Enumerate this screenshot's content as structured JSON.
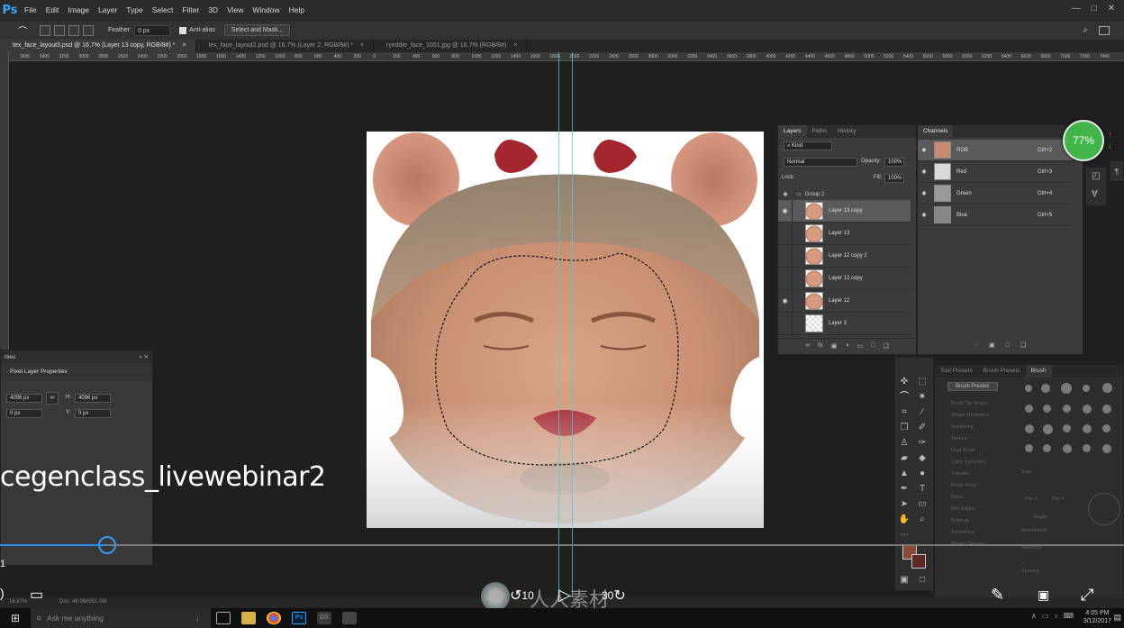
{
  "app": {
    "logo": "Ps"
  },
  "menu": [
    "File",
    "Edit",
    "Image",
    "Layer",
    "Type",
    "Select",
    "Filter",
    "3D",
    "View",
    "Window",
    "Help"
  ],
  "window_controls": [
    "—",
    "□",
    "✕"
  ],
  "options_bar": {
    "feather_label": "Feather:",
    "feather_value": "0 px",
    "antialias_label": "Anti-alias",
    "select_mask_label": "Select and Mask..."
  },
  "doc_tabs": [
    {
      "label": "tex_face_layout3.psd @ 16.7% (Layer 13 copy, RGB/8#) *",
      "close": "×"
    },
    {
      "label": "tex_face_layout2.psd @ 16.7% (Layer 2, RGB/8#) *",
      "close": "×"
    },
    {
      "label": "ryeddie_face_1001.jpg @ 16.7% (RGB/8#)",
      "close": "×"
    }
  ],
  "ruler_ticks": [
    "3600",
    "3400",
    "3200",
    "3000",
    "2800",
    "2600",
    "2400",
    "2200",
    "2000",
    "1800",
    "1600",
    "1400",
    "1200",
    "1000",
    "800",
    "600",
    "400",
    "200",
    "0",
    "200",
    "400",
    "600",
    "800",
    "1000",
    "1200",
    "1400",
    "1600",
    "1800",
    "2000",
    "2200",
    "2400",
    "2600",
    "2800",
    "3000",
    "3200",
    "3400",
    "3600",
    "3800",
    "4000",
    "4200",
    "4400",
    "4600",
    "4800",
    "5000",
    "5200",
    "5400",
    "5600",
    "5800",
    "6000",
    "6200",
    "6400",
    "6600",
    "6800",
    "7000",
    "7200",
    "7400"
  ],
  "layers_panel": {
    "tabs": [
      "Layers",
      "Paths",
      "History"
    ],
    "kind_label": "Kind",
    "blend_mode": "Normal",
    "opacity_label": "Opacity:",
    "opacity_value": "100%",
    "lock_label": "Lock:",
    "fill_label": "Fill:",
    "fill_value": "100%",
    "group_name": "Group 2",
    "layers": [
      {
        "name": "Layer 13 copy",
        "visible": true,
        "selected": true
      },
      {
        "name": "Layer 13",
        "visible": false,
        "selected": false
      },
      {
        "name": "Layer 12 copy 2",
        "visible": false,
        "selected": false
      },
      {
        "name": "Layer 12 copy",
        "visible": false,
        "selected": false
      },
      {
        "name": "Layer 12",
        "visible": true,
        "selected": false
      },
      {
        "name": "Layer 3",
        "visible": false,
        "selected": false
      }
    ],
    "footer_icons": [
      "link-icon",
      "fx-icon",
      "mask-icon",
      "adjustment-icon",
      "folder-icon",
      "new-layer-icon",
      "trash-icon"
    ]
  },
  "channels_panel": {
    "tab": "Channels",
    "channels": [
      {
        "name": "RGB",
        "shortcut": "Ctrl+2",
        "selected": true,
        "color": "#c98a74"
      },
      {
        "name": "Red",
        "shortcut": "Ctrl+3",
        "selected": false,
        "color": "#d9d9d9"
      },
      {
        "name": "Green",
        "shortcut": "Ctrl+4",
        "selected": false,
        "color": "#9a9a9a"
      },
      {
        "name": "Blue",
        "shortcut": "Ctrl+5",
        "selected": false,
        "color": "#888888"
      }
    ]
  },
  "properties_panel": {
    "title": "rties",
    "subtitle": "Pixel Layer Properties",
    "w_value": "4096 px",
    "h_label": "H:",
    "h_value": "4096 px",
    "x_value": "0 px",
    "y_label": "Y:",
    "y_value": "0 px"
  },
  "brush_panel": {
    "tabs": [
      "Tool Presets",
      "Brush Presets",
      "Brush"
    ],
    "presets_button": "Brush Presets",
    "options": [
      "Brush Tip Shape",
      "Shape Dynamics",
      "Scattering",
      "Texture",
      "Dual Brush",
      "Color Dynamics",
      "Transfer",
      "Brush Pose",
      "Noise",
      "Wet Edges",
      "Build-up",
      "Smoothing",
      "Protect Texture"
    ],
    "size_label": "Size",
    "flip_x": "Flip X",
    "flip_y": "Flip Y",
    "angle_label": "Angle:",
    "roundness_label": "Roundness:",
    "hardness_label": "Hardness",
    "spacing_label": "Spacing"
  },
  "video_overlay": {
    "title": "cegenclass_livewebinar2",
    "progress": 0.095,
    "time_left_fragment": "1",
    "rewind_label": "10",
    "forward_label": "30",
    "watermark": "人人素材"
  },
  "zoom_badge": "77%",
  "status": {
    "zoom": "16.67%",
    "doc": "Doc: 48.0M/551.0M"
  },
  "taskbar": {
    "search_placeholder": "Ask me anything",
    "time": "4:05 PM",
    "date": "3/12/2017"
  },
  "colors": {
    "accent": "#31a8ff",
    "guide": "#3fd6d6",
    "badge": "#3fb54a",
    "progress": "#2d8ce6",
    "foreground_swatch": "#8a4a38",
    "background_swatch": "#5a2a22"
  }
}
